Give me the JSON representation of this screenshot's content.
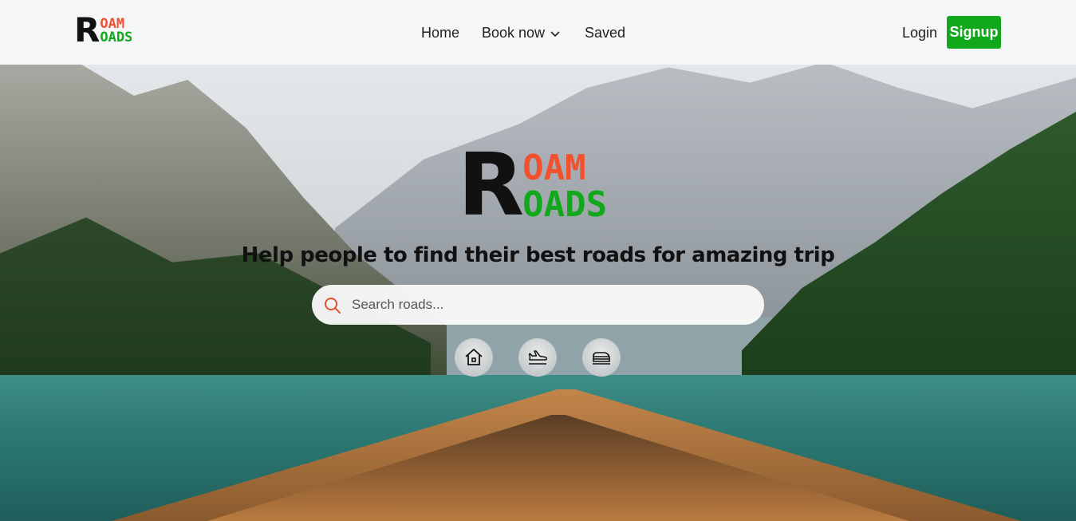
{
  "brand": {
    "big_letter": "R",
    "top_word": "OAM",
    "bottom_word": "OADS",
    "colors": {
      "letter": "#111111",
      "top": "#f0522f",
      "bottom": "#12a81c"
    }
  },
  "nav": {
    "home": "Home",
    "book_now": "Book now",
    "saved": "Saved",
    "login": "Login",
    "signup": "Signup"
  },
  "hero": {
    "tagline": "Help people to find their best roads for amazing trip",
    "search_placeholder": "Search roads..."
  },
  "categories": [
    {
      "icon": "home-icon"
    },
    {
      "icon": "flight-icon"
    },
    {
      "icon": "train-icon"
    }
  ],
  "accent_color": "#12a81c"
}
